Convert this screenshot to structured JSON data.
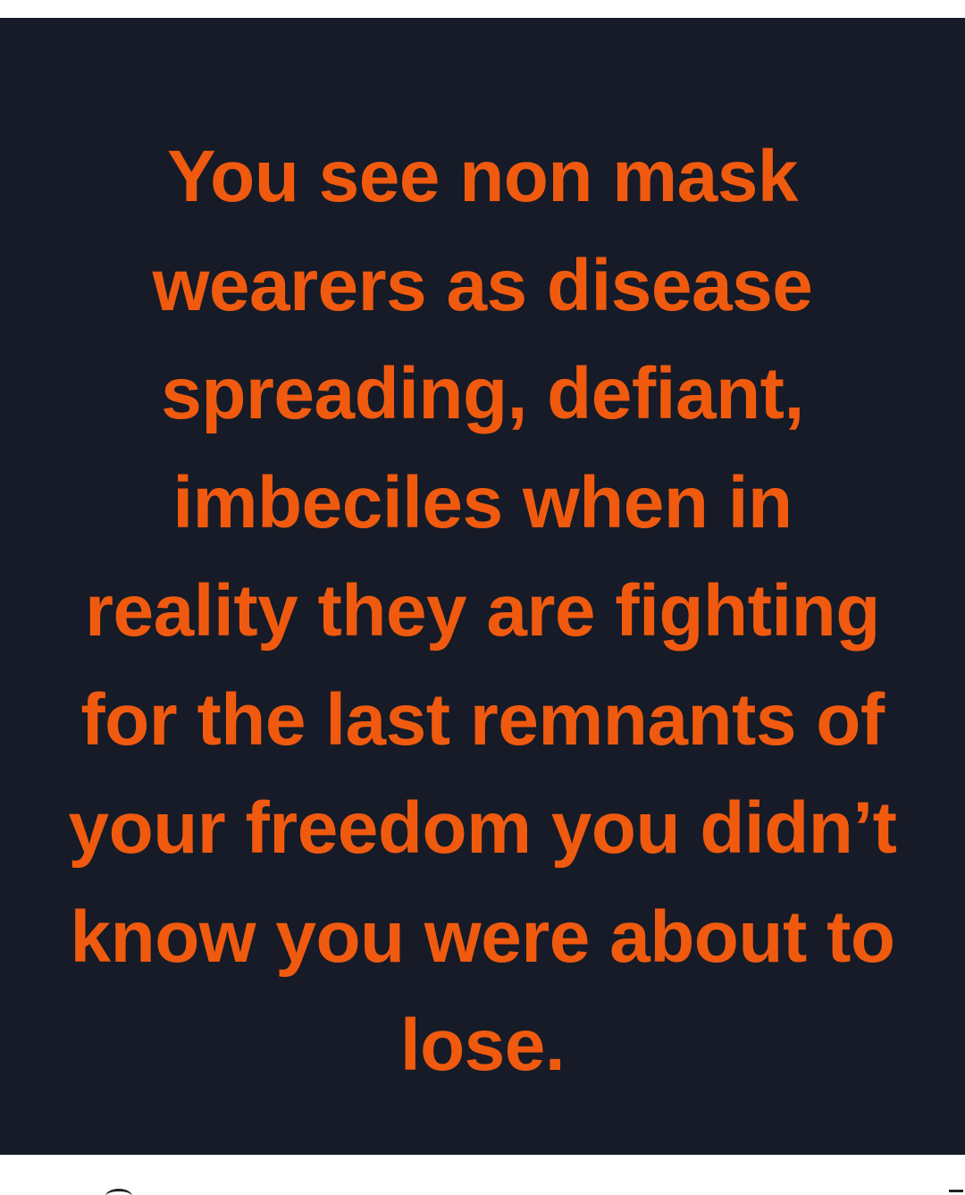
{
  "quote": {
    "lines": [
      "You see non mask",
      "wearers as disease",
      "spreading, defiant,",
      "imbeciles when in",
      "reality they are fighting",
      "for the last remnants of",
      "your freedom you didn’t",
      "know you were about to",
      "lose."
    ],
    "text_color": "#f05a0f",
    "background_color": "#161b27"
  }
}
